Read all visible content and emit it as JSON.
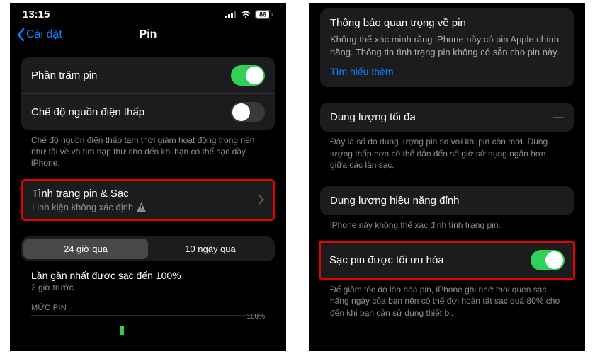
{
  "status": {
    "time": "13:15",
    "batt": "86"
  },
  "nav": {
    "back": "Cài đặt",
    "title": "Pin"
  },
  "left": {
    "battPct": "Phần trăm pin",
    "lowPower": "Chế độ nguồn điện thấp",
    "lowPowerNote": "Chế độ nguồn điện thấp tạm thời giảm hoạt động trong nền như tải về và tìm nạp thư cho đến khi bạn có thể sạc đầy iPhone.",
    "healthTitle": "Tình trạng pin & Sạc",
    "healthSub": "Linh kiện không xác định",
    "seg24": "24 giờ qua",
    "seg10": "10 ngày qua",
    "lastCharge": "Lần gần nhất được sạc đến 100%",
    "lastChargeSub": "2 giờ trước",
    "mucPin": "MỨC PIN",
    "pct100": "100%"
  },
  "right": {
    "noticeTitle": "Thông báo quan trọng về pin",
    "noticeBody": "Không thể xác minh rằng iPhone này có pin Apple chính hãng. Thông tin tình trạng pin không có sẵn cho pin này.",
    "learnMore": "Tìm hiểu thêm",
    "maxCap": "Dung lượng tối đa",
    "maxCapVal": "—",
    "maxCapNote": "Đây là số đo dung lượng pin so với khi pin còn mới. Dung lượng thấp hơn có thể dẫn đến số giờ sử dụng ngắn hơn giữa các lần sạc.",
    "peak": "Dung lượng hiệu năng đỉnh",
    "peakNote": "iPhone này không thể xác định tình trạng pin.",
    "opt": "Sạc pin được tối ưu hóa",
    "optNote": "Để giảm tốc độ lão hóa pin, iPhone ghi nhớ thói quen sạc hằng ngày của bạn nên có thể đợi hoàn tất sạc quá 80% cho đến khi bạn cần sử dụng thiết bị."
  }
}
